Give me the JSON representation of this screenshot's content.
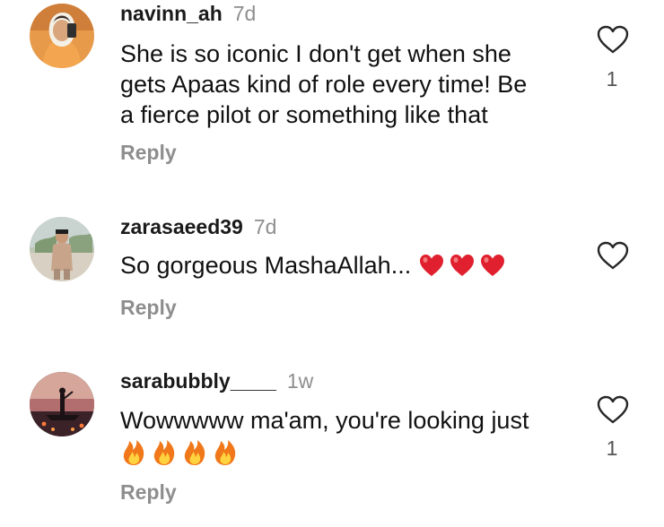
{
  "comments": [
    {
      "username": "navinn_ah",
      "time": "7d",
      "text_lines": [
        "She is so iconic I don't get when she",
        "gets Apaas kind of role every time! Be",
        "a fierce pilot or something like that"
      ],
      "reply_label": "Reply",
      "like_count": "1",
      "avatar_icon": "avatar-woman-orange-scarf"
    },
    {
      "username": "zarasaeed39",
      "time": "7d",
      "text": "So gorgeous MashaAllah...",
      "emoji": [
        "red-heart",
        "red-heart",
        "red-heart"
      ],
      "reply_label": "Reply",
      "like_count": "",
      "avatar_icon": "avatar-person-outdoors"
    },
    {
      "username": "sarabubbly____",
      "time": "1w",
      "text": "Wowwwww ma'am, you're looking just",
      "emoji": [
        "fire",
        "fire",
        "fire",
        "fire"
      ],
      "reply_label": "Reply",
      "like_count": "1",
      "avatar_icon": "avatar-sunset-boat"
    }
  ],
  "colors": {
    "text": "#111111",
    "muted": "#8e8e8e",
    "heart": "#e0202e",
    "fire": "#f07a12"
  }
}
